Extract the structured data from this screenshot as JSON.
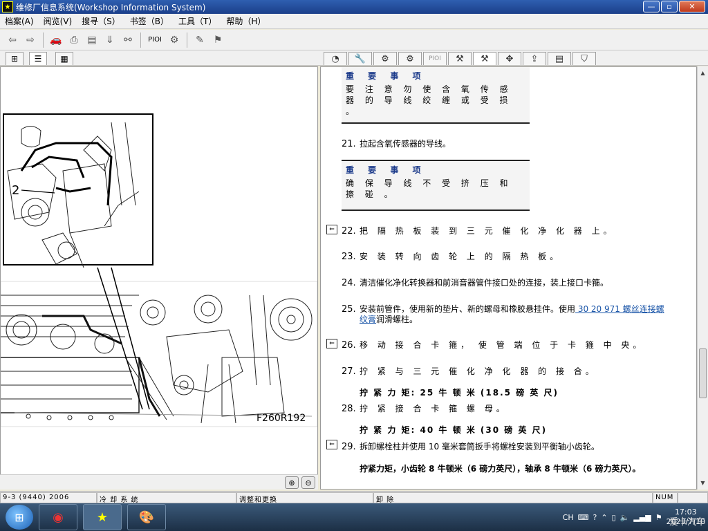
{
  "window": {
    "title": "维修厂信息系统(Workshop Information System)",
    "controls": {
      "minimize": "—",
      "maximize": "▫",
      "close": "✕"
    }
  },
  "menu": [
    "档案(A)",
    "阅览(V)",
    "搜寻（S）",
    "书签（B）",
    "工具（T）",
    "帮助（H）"
  ],
  "toolbar": {
    "pioi_label": "PIOI"
  },
  "right_tabs": {
    "pioi_label": "PIOI"
  },
  "figure": {
    "callout": "2",
    "code": "F260R192"
  },
  "content": {
    "note1": {
      "heading": "重 要 事 项",
      "body": "要 注 意 勿 使 含 氧 传 感 器 的 导 线 绞 缠 或 受 损 。"
    },
    "step21": {
      "num": "21.",
      "text": "拉起含氧传感器的导线。"
    },
    "note2": {
      "heading": "重 要 事 项",
      "body": "确 保 导 线 不 受 挤 压 和 擦 碰 。"
    },
    "step22": {
      "num": "22.",
      "text": "把 隔 热 板 装 到 三 元 催 化 净 化 器 上。"
    },
    "step23": {
      "num": "23.",
      "text": "安 装 转 向 齿 轮 上 的 隔 热 板。"
    },
    "step24": {
      "num": "24.",
      "text": "清洁催化净化转换器和前消音器管件接口处的连接，装上接口卡箍。"
    },
    "step25": {
      "num": "25.",
      "text_before": "安装前管件，使用新的垫片、新的螺母和橡胶悬挂件。使用",
      "link": " 30 20 971 螺丝连接螺纹膏",
      "text_after": "润滑螺柱。"
    },
    "step26": {
      "num": "26.",
      "text": "移 动 接 合 卡 箍， 使 管 端 位 于 卡 箍 中 央。"
    },
    "step27": {
      "num": "27.",
      "text": "拧 紧 与 三 元 催 化 净 化 器 的 接 合。",
      "torque": "拧 紧 力 矩: 25 牛 顿 米 (18.5 磅 英 尺)"
    },
    "step28": {
      "num": "28.",
      "text": "拧 紧 接 合 卡 箍 螺 母。",
      "torque": "拧 紧 力 矩: 40 牛 顿 米 (30 磅 英 尺)"
    },
    "step29": {
      "num": "29.",
      "text": "拆卸螺栓柱并使用 10 毫米套筒扳手将螺栓安装到平衡轴小齿轮。",
      "torque": "拧紧力矩，小齿轮 8 牛顿米（6 磅力英尺），轴承 8 牛顿米（6 磅力英尺）。"
    }
  },
  "status": {
    "model": "9-3 (9440) 2006",
    "section": "冷 却 系 统",
    "operation": "调整和更换",
    "action": "卸 除",
    "numlock": "NUM"
  },
  "taskbar": {
    "ime": "CH",
    "time": "17:03",
    "date": "2023/7/10",
    "watermark": "爱卡汽车"
  }
}
